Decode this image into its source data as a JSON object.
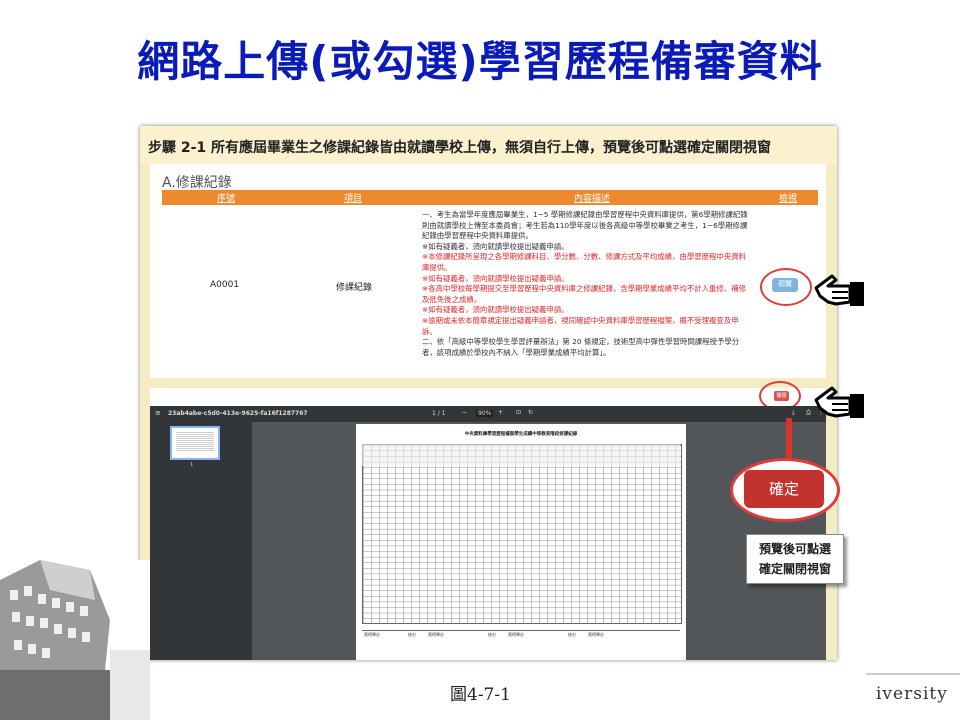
{
  "slide": {
    "title": "網路上傳(或勾選)學習歷程備審資料",
    "caption": "圖4-7-1",
    "footer_logo_text": "iversity"
  },
  "step": {
    "text": "步驟 2-1 所有應屆畢業生之修課紀錄皆由就讀學校上傳，無須自行上傳，預覽後可點選確定關閉視窗"
  },
  "course_record": {
    "section_title": "A.修課紀錄",
    "columns": [
      "序號",
      "項目",
      "內容描述",
      "檢視"
    ],
    "row": {
      "id": "A0001",
      "item": "修課紀錄",
      "desc_lines": [
        {
          "text": "一、考生為當學年度應屆畢業生，1~5 學期修課紀錄由學習歷程中央資料庫提供，第6學期修課紀錄則由就讀學校上傳至本委員會；考生若為110學年度以後各高級中等學校畢業之考生，1~6學期修課紀錄由學習歷程中央資料庫提供。",
          "red": false
        },
        {
          "text": "※如有疑義者，須向就讀學校提出疑義申請。",
          "red": false
        },
        {
          "text": "※本修課紀錄所呈現之各學期修課科目、學分數、分數、修課方式及平均成績，由學習歷程中央資料庫提供。",
          "red": true
        },
        {
          "text": "※如有疑義者，須向就讀學校提出疑義申請。",
          "red": true
        },
        {
          "text": "※各高中學校每學期提交至學習歷程中央資料庫之修課紀錄，含學期學業成績平均不計入重修、補修及抵免後之成績。",
          "red": true
        },
        {
          "text": "※如有疑義者，須向就讀學校提出疑義申請。",
          "red": true
        },
        {
          "text": "※逾期或未依本簡章規定提出疑義申請者，視同確認中央資料庫學習歷程檔案，概不受理複查及申訴。",
          "red": true
        },
        {
          "text": "二、依「高級中等學校學生學習評量辦法」第 20 條規定，技術型高中彈性學習時間課程授予學分者，該項成績於學校內不納入「學期學業成績平均計算」。",
          "red": false
        }
      ],
      "preview_label": "預覽"
    }
  },
  "pdf_viewer": {
    "close_label": "關閉",
    "filename": "23ab4abe-c5d0-413e-9625-fa16f1287767",
    "page_indicator": "1 / 1",
    "zoom": "90%",
    "thumb_number": "1",
    "doc_title": "中央資料庫學習歷程檔案學生成績中等教育階段修課紀錄",
    "footer_labels": [
      "實得學分",
      "核分",
      "實得學分",
      "核分",
      "實得學分",
      "核分",
      "實得學分"
    ]
  },
  "callout": {
    "confirm_label": "確定",
    "note_line1": "預覽後可點選",
    "note_line2": "確定關閉視窗"
  },
  "colors": {
    "title": "#0a1bb8",
    "table_header": "#ee8a2e",
    "highlight_ring": "#e23b3b",
    "confirm_button": "#c2332d",
    "preview_button": "#7fb4e0"
  }
}
